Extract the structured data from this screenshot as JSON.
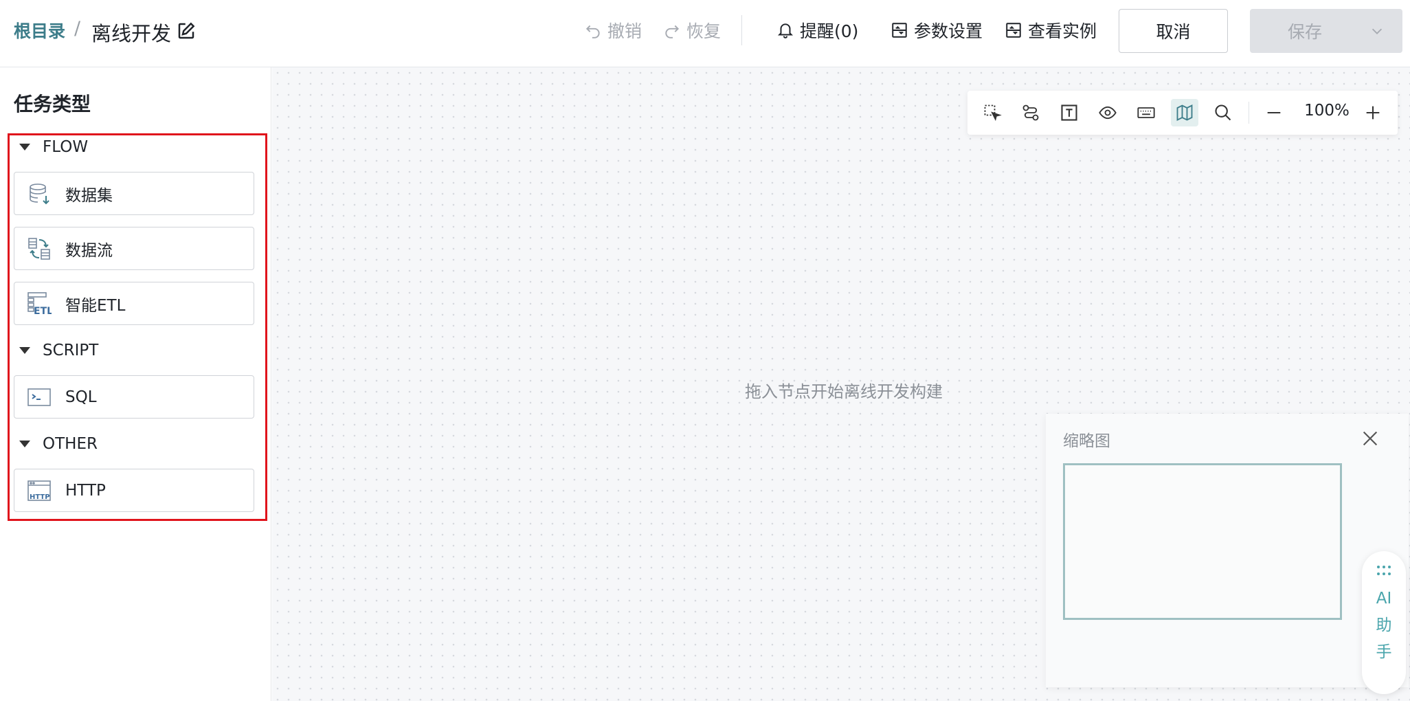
{
  "breadcrumb": {
    "root": "根目录",
    "separator": "/",
    "title": "离线开发"
  },
  "header": {
    "undo_label": "撤销",
    "redo_label": "恢复",
    "reminder_label": "提醒(0)",
    "params_label": "参数设置",
    "instances_label": "查看实例",
    "cancel_label": "取消",
    "save_label": "保存"
  },
  "sidebar": {
    "title": "任务类型",
    "groups": [
      {
        "name": "FLOW",
        "items": [
          {
            "label": "数据集",
            "icon": "dataset-icon"
          },
          {
            "label": "数据流",
            "icon": "dataflow-icon"
          },
          {
            "label": "智能ETL",
            "icon": "etl-icon"
          }
        ]
      },
      {
        "name": "SCRIPT",
        "items": [
          {
            "label": "SQL",
            "icon": "sql-icon"
          }
        ]
      },
      {
        "name": "OTHER",
        "items": [
          {
            "label": "HTTP",
            "icon": "http-icon"
          }
        ]
      }
    ],
    "highlight_color": "#e0141c"
  },
  "canvas": {
    "placeholder": "拖入节点开始离线开发构建",
    "toolbar": {
      "tools": [
        "select-icon",
        "connect-icon",
        "text-icon",
        "preview-icon",
        "keyboard-icon",
        "minimap-icon",
        "search-icon",
        "zoom-out-icon",
        "zoom-in-icon"
      ],
      "active_tool": "minimap-icon",
      "zoom": "100%"
    },
    "minimap": {
      "title": "缩略图"
    }
  },
  "ai_helper": {
    "chars": [
      "AI",
      "助",
      "手"
    ]
  },
  "colors": {
    "accent": "#3d7d8a",
    "ai": "#4aa5ac",
    "disabled": "#a7abb2"
  }
}
